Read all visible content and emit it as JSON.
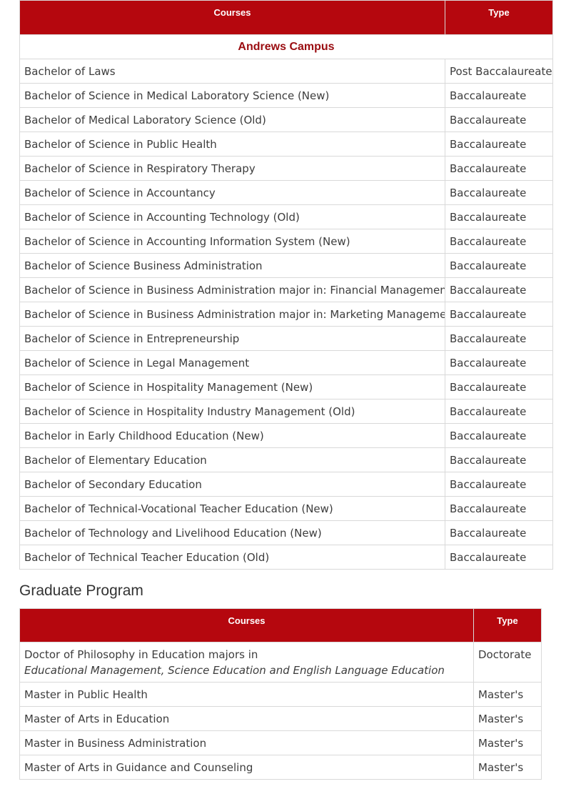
{
  "undergrad": {
    "headers": {
      "courses": "Courses",
      "type": "Type"
    },
    "campus": "Andrews Campus",
    "rows": [
      {
        "course": "Bachelor of Laws",
        "type": "Post Baccalaureate"
      },
      {
        "course": "Bachelor of Science in Medical Laboratory Science (New)",
        "type": "Baccalaureate"
      },
      {
        "course": "Bachelor of Medical Laboratory Science (Old)",
        "type": "Baccalaureate"
      },
      {
        "course": "Bachelor of Science in Public Health",
        "type": "Baccalaureate"
      },
      {
        "course": "Bachelor of Science in Respiratory Therapy",
        "type": "Baccalaureate"
      },
      {
        "course": "Bachelor of Science in Accountancy",
        "type": "Baccalaureate"
      },
      {
        "course": "Bachelor of Science in Accounting Technology (Old)",
        "type": "Baccalaureate"
      },
      {
        "course": "Bachelor of Science in Accounting Information System (New)",
        "type": "Baccalaureate"
      },
      {
        "course": "Bachelor of Science Business Administration",
        "type": "Baccalaureate"
      },
      {
        "course": "Bachelor of Science in Business Administration major in: Financial Management",
        "type": "Baccalaureate"
      },
      {
        "course": "Bachelor of Science in Business Administration major in: Marketing Management",
        "type": "Baccalaureate"
      },
      {
        "course": "Bachelor of Science in Entrepreneurship",
        "type": "Baccalaureate"
      },
      {
        "course": "Bachelor of Science in Legal Management",
        "type": "Baccalaureate"
      },
      {
        "course": "Bachelor of Science in Hospitality Management (New)",
        "type": "Baccalaureate"
      },
      {
        "course": "Bachelor of Science in Hospitality Industry Management (Old)",
        "type": "Baccalaureate"
      },
      {
        "course": "Bachelor in Early Childhood Education (New)",
        "type": "Baccalaureate"
      },
      {
        "course": "Bachelor of Elementary Education",
        "type": "Baccalaureate"
      },
      {
        "course": "Bachelor of Secondary Education",
        "type": "Baccalaureate"
      },
      {
        "course": "Bachelor of Technical-Vocational Teacher Education (New)",
        "type": "Baccalaureate"
      },
      {
        "course": "Bachelor of Technology and Livelihood Education (New)",
        "type": "Baccalaureate"
      },
      {
        "course": "Bachelor of Technical Teacher Education (Old)",
        "type": "Baccalaureate"
      }
    ]
  },
  "graduate": {
    "heading": "Graduate Program",
    "headers": {
      "courses": "Courses",
      "type": "Type"
    },
    "phd": {
      "course": "Doctor of Philosophy in Education majors in",
      "majors": "Educational Management, Science Education and English Language Education",
      "type": "Doctorate"
    },
    "rows": [
      {
        "course": "Master in Public Health",
        "type": "Master's"
      },
      {
        "course": "Master of Arts in Education",
        "type": "Master's"
      },
      {
        "course": "Master in Business Administration",
        "type": "Master's"
      },
      {
        "course": "Master of Arts in Guidance and Counseling",
        "type": "Master's"
      }
    ]
  }
}
